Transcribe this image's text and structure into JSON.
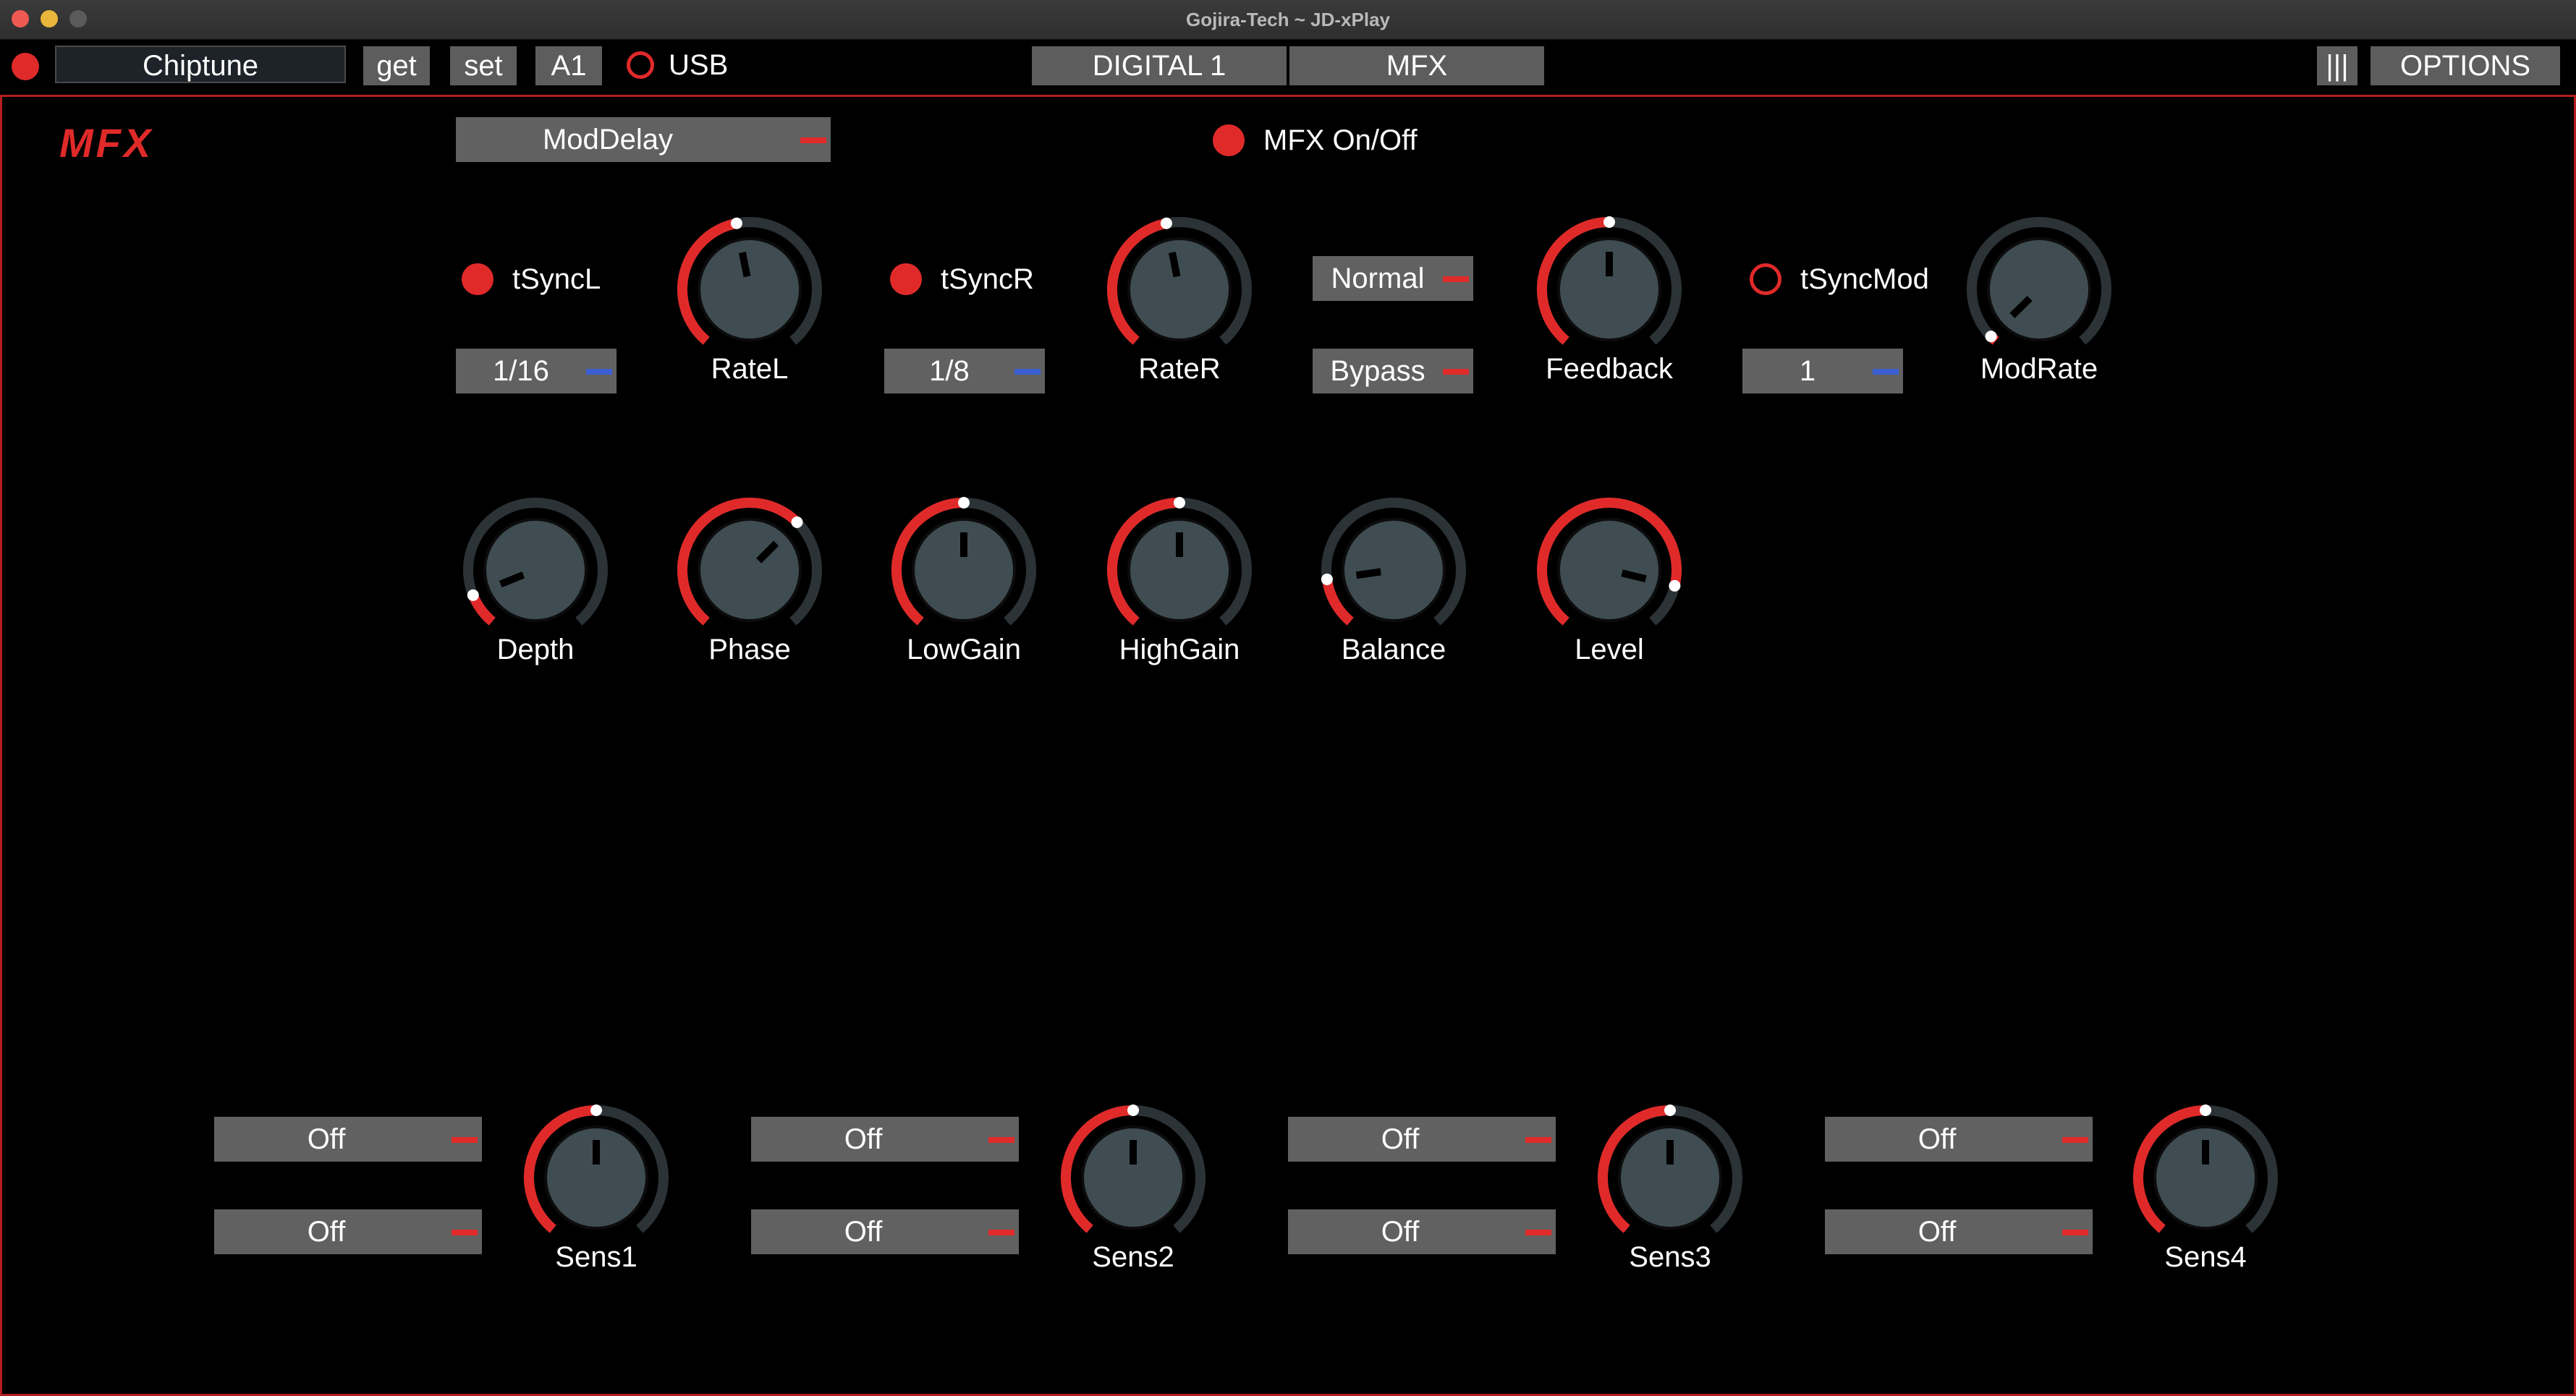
{
  "window": {
    "title": "Gojira-Tech ~ JD-xPlay"
  },
  "toolbar": {
    "patch_name": "Chiptune",
    "get_label": "get",
    "set_label": "set",
    "bank_label": "A1",
    "usb_label": "USB",
    "tab_digital": "DIGITAL 1",
    "tab_mfx": "MFX",
    "menu_label": "|||",
    "options_label": "OPTIONS"
  },
  "colors": {
    "accent": "#e02a2a",
    "blue": "#3a5fd1",
    "knob_body": "#3f4d52",
    "track": "#2b3337"
  },
  "mfx": {
    "logo": "MFX",
    "type_select": "ModDelay",
    "onoff_label": "MFX On/Off",
    "tsyncL_label": "tSyncL",
    "tsyncR_label": "tSyncR",
    "tsyncMod_label": "tSyncMod",
    "noteL": "1/16",
    "noteR": "1/8",
    "noteMod": "1",
    "mode_select": "Normal",
    "bypass_select": "Bypass",
    "knobs": [
      {
        "label": "RateL",
        "value": 0.46
      },
      {
        "label": "RateR",
        "value": 0.46
      },
      {
        "label": "Feedback",
        "value": 0.5
      },
      {
        "label": "ModRate",
        "value": 0.02
      },
      {
        "label": "Depth",
        "value": 0.1
      },
      {
        "label": "Phase",
        "value": 0.66
      },
      {
        "label": "LowGain",
        "value": 0.5
      },
      {
        "label": "HighGain",
        "value": 0.5
      },
      {
        "label": "Balance",
        "value": 0.15
      },
      {
        "label": "Level",
        "value": 0.87
      }
    ],
    "sens": [
      {
        "src1": "Off",
        "src2": "Off",
        "label": "Sens1",
        "value": 0.5
      },
      {
        "src1": "Off",
        "src2": "Off",
        "label": "Sens2",
        "value": 0.5
      },
      {
        "src1": "Off",
        "src2": "Off",
        "label": "Sens3",
        "value": 0.5
      },
      {
        "src1": "Off",
        "src2": "Off",
        "label": "Sens4",
        "value": 0.5
      }
    ]
  }
}
